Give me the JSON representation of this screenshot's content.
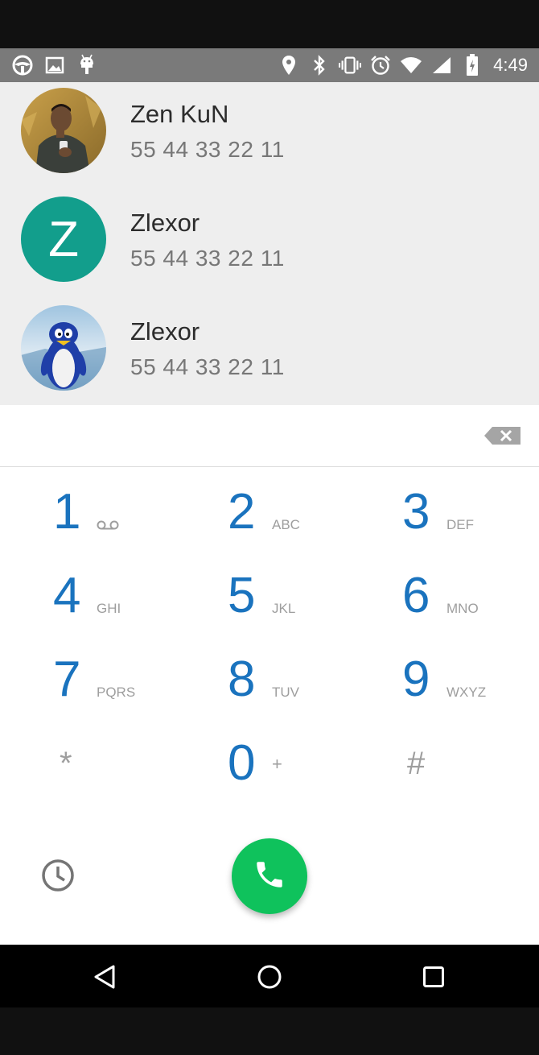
{
  "status_bar": {
    "time": "4:49",
    "left_icons": [
      "steering-wheel-icon",
      "image-icon",
      "android-icon"
    ],
    "right_icons": [
      "location-icon",
      "bluetooth-icon",
      "vibrate-icon",
      "alarm-icon",
      "wifi-icon",
      "signal-icon",
      "battery-icon"
    ]
  },
  "contacts": [
    {
      "name": "Zen KuN",
      "number": "55 44 33 22 11",
      "avatar": "photo"
    },
    {
      "name": "Zlexor",
      "number": "55 44 33 22 11",
      "avatar": "letter",
      "letter": "Z",
      "avatar_color": "#129e8c"
    },
    {
      "name": "Zlexor",
      "number": "55 44 33 22 11",
      "avatar": "photo"
    }
  ],
  "dial_input": {
    "value": ""
  },
  "keypad": {
    "keys": [
      {
        "digit": "1",
        "letters": "",
        "icon": "voicemail-icon"
      },
      {
        "digit": "2",
        "letters": "ABC"
      },
      {
        "digit": "3",
        "letters": "DEF"
      },
      {
        "digit": "4",
        "letters": "GHI"
      },
      {
        "digit": "5",
        "letters": "JKL"
      },
      {
        "digit": "6",
        "letters": "MNO"
      },
      {
        "digit": "7",
        "letters": "PQRS"
      },
      {
        "digit": "8",
        "letters": "TUV"
      },
      {
        "digit": "9",
        "letters": "WXYZ"
      },
      {
        "digit": "*",
        "letters": ""
      },
      {
        "digit": "0",
        "letters": "+"
      },
      {
        "digit": "#",
        "letters": ""
      }
    ]
  },
  "colors": {
    "accent": "#1a73be",
    "call_button": "#0fc25c",
    "status_bar": "#7a7a7a",
    "contact_list_bg": "#eeeeee"
  },
  "nav_bar": {
    "buttons": [
      "back-icon",
      "home-icon",
      "recents-icon"
    ]
  }
}
